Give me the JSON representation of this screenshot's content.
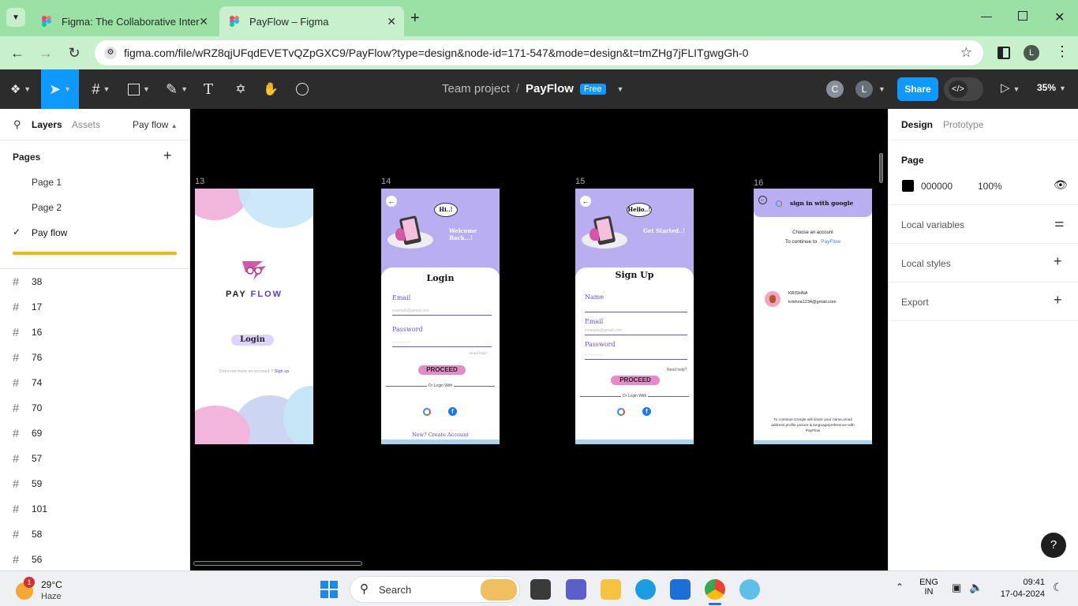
{
  "browser": {
    "tabs": [
      {
        "title": "Figma: The Collaborative Inter"
      },
      {
        "title": "PayFlow – Figma"
      }
    ],
    "url": "figma.com/file/wRZ8qjUFqdEVETvQZpGXC9/PayFlow?type=design&node-id=171-547&mode=design&t=tmZHg7jFLITgwgGh-0",
    "profile_initial": "L"
  },
  "toolbar": {
    "team": "Team project",
    "separator": "/",
    "file": "PayFlow",
    "plan_badge": "Free",
    "avatars": [
      "C",
      "L"
    ],
    "share_label": "Share",
    "zoom": "35%"
  },
  "left_panel": {
    "tabs": [
      "Layers",
      "Assets"
    ],
    "page_selector": "Pay flow",
    "pages_heading": "Pages",
    "pages": [
      {
        "name": "Page 1",
        "selected": false
      },
      {
        "name": "Page 2",
        "selected": false
      },
      {
        "name": "Pay flow",
        "selected": true
      }
    ],
    "layers": [
      "38",
      "17",
      "16",
      "76",
      "74",
      "70",
      "69",
      "57",
      "59",
      "101",
      "58",
      "56"
    ]
  },
  "canvas": {
    "frames": [
      {
        "label": "13",
        "brand": "PAY",
        "brand_accent": "FLOW",
        "login_button": "Login",
        "footer_text": "Does not have an account ?",
        "footer_link": "Sign up"
      },
      {
        "label": "14",
        "bubble": "Hi..!",
        "welcome": "Welcome Back...!",
        "heading": "Login",
        "email_label": "Email",
        "email_placeholder": "example@gmail.com",
        "password_label": "Password",
        "password_placeholder": "................",
        "help": "Need help?",
        "proceed": "PROCEED",
        "or": "Or Login With",
        "create": "New? Create Account"
      },
      {
        "label": "15",
        "bubble": "Hello..!",
        "started": "Get Started..!",
        "heading": "Sign Up",
        "name_label": "Name",
        "email_label": "Email",
        "email_placeholder": "example@gmail.com",
        "password_label": "Password",
        "password_placeholder": "................",
        "help": "Need help?",
        "proceed": "PROCEED",
        "or": "Or Login With"
      },
      {
        "label": "16",
        "title": "sign in with google",
        "choose": "Choose an account",
        "continue": "To continue to",
        "app": "PayFlow",
        "account_name": "KRISHNA",
        "account_email": "krishna1234@gmail.com",
        "disclaimer": "To continue,Google will share your name,email address,profile picture & languagepreference with PayFlow"
      }
    ]
  },
  "right_panel": {
    "tabs": [
      "Design",
      "Prototype"
    ],
    "page_heading": "Page",
    "color_hex": "000000",
    "opacity": "100%",
    "sections": [
      "Local variables",
      "Local styles",
      "Export"
    ]
  },
  "taskbar": {
    "temperature": "29°C",
    "condition": "Haze",
    "weather_badge": "1",
    "search": "Search",
    "lang_top": "ENG",
    "lang_bottom": "IN",
    "time": "09:41",
    "date": "17-04-2024"
  },
  "colors": {
    "tabbar": "#9be0a4",
    "addrbar": "#c9f0cd",
    "figma_toolbar": "#2c2c2c",
    "share_blue": "#0d99ff",
    "lavender": "#b9aef0",
    "pink": "#e58bc8",
    "pageflow_accent": "#f5b800"
  }
}
